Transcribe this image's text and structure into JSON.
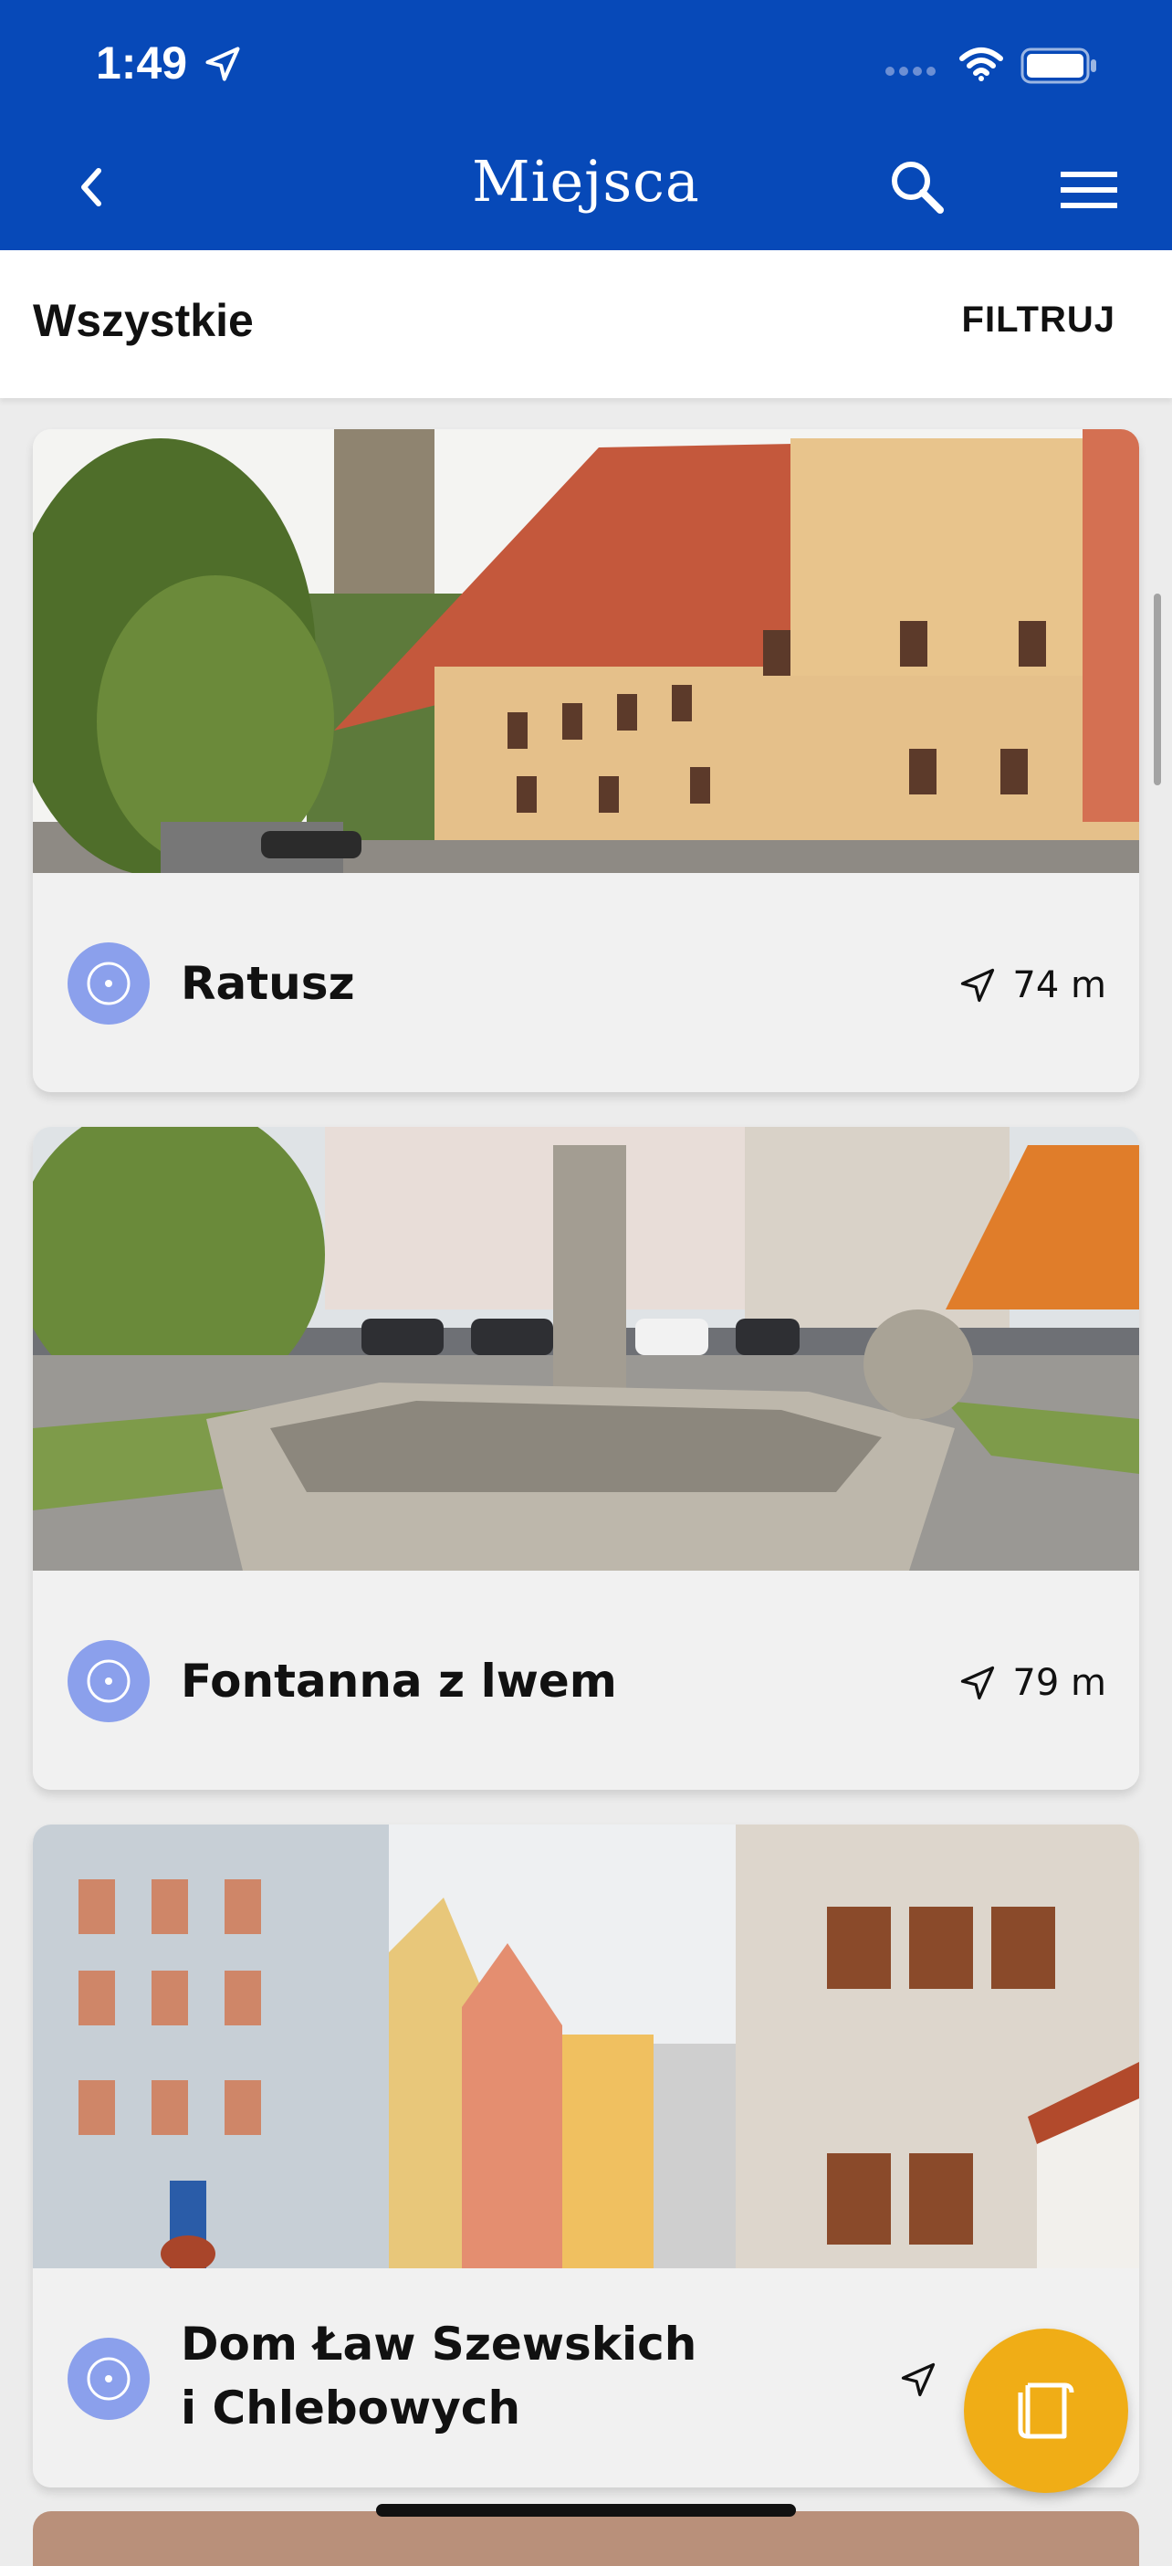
{
  "status": {
    "time": "1:49"
  },
  "header": {
    "title": "Miejsca"
  },
  "filter_bar": {
    "title": "Wszystkie",
    "filter_label": "FILTRUJ"
  },
  "places": [
    {
      "name": "Ratusz",
      "distance": "74 m"
    },
    {
      "name": "Fontanna z lwem",
      "distance": "79 m"
    },
    {
      "name_line1": "Dom Ław Szewskich",
      "name_line2": "i Chlebowych"
    }
  ],
  "colors": {
    "accent": "#0749b8",
    "marker": "#8ba0ec",
    "fab": "#f0ad16"
  },
  "icons": {
    "back": "back-icon",
    "search": "search-icon",
    "menu": "menu-icon",
    "marker": "location-marker-icon",
    "distance": "navigation-arrow-icon",
    "fab": "guide-book-icon"
  }
}
